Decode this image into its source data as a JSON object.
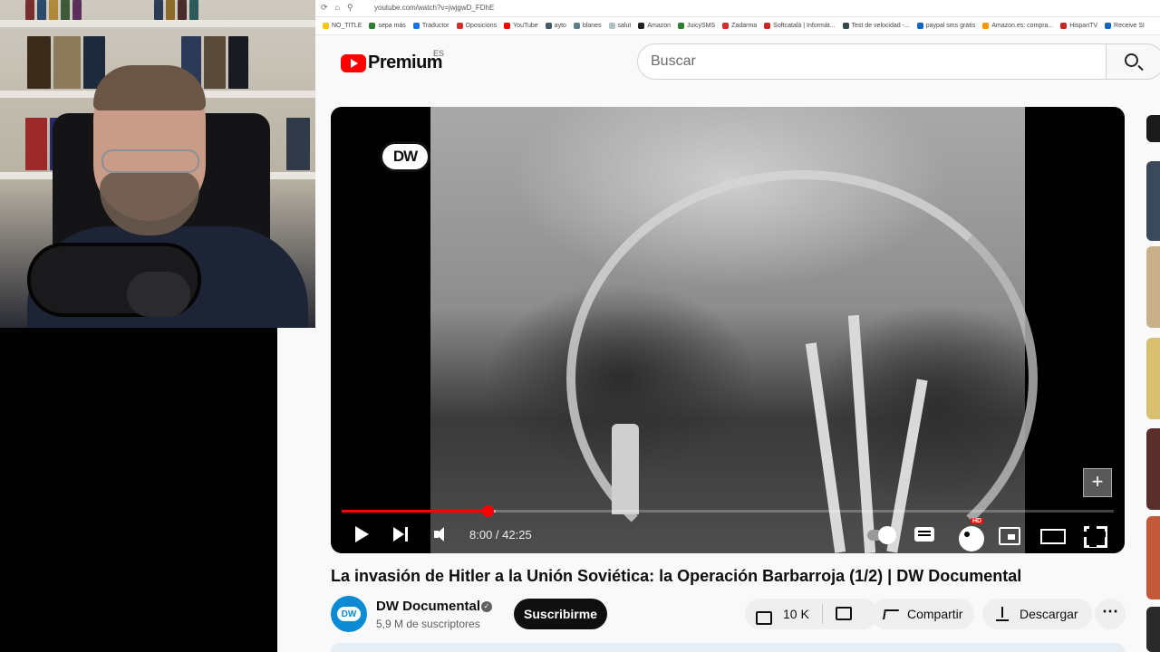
{
  "browser": {
    "url": "youtube.com/watch?v=jwjgwD_FDhE",
    "bookmarks": [
      {
        "label": "NO_TITLE",
        "color": "#f5c518"
      },
      {
        "label": "sepa más",
        "color": "#2e7d32"
      },
      {
        "label": "Traductor",
        "color": "#1a73e8"
      },
      {
        "label": "Oposicions",
        "color": "#d32f2f"
      },
      {
        "label": "YouTube",
        "color": "#ff0000"
      },
      {
        "label": "ayto",
        "color": "#455a64"
      },
      {
        "label": "blanes",
        "color": "#607d8b"
      },
      {
        "label": "salut",
        "color": "#b0bec5"
      },
      {
        "label": "Amazon",
        "color": "#222222"
      },
      {
        "label": "JuicySMS",
        "color": "#2e7d32"
      },
      {
        "label": "Zadarma",
        "color": "#d32f2f"
      },
      {
        "label": "Softcatalà | Informàt...",
        "color": "#c62828"
      },
      {
        "label": "Test de velocidad -...",
        "color": "#37474f"
      },
      {
        "label": "paypal sms gratis",
        "color": "#1565c0"
      },
      {
        "label": "Amazon.es: compra...",
        "color": "#ff9800"
      },
      {
        "label": "HispanTV",
        "color": "#c62828"
      },
      {
        "label": "Receive SI",
        "color": "#1565c0"
      }
    ]
  },
  "header": {
    "logo_text": "Premium",
    "region": "ES",
    "search_placeholder": "Buscar"
  },
  "player": {
    "overlay_logo": "DW",
    "add_label": "+",
    "time_current": "8:00",
    "time_separator": " / ",
    "time_total": "42:25",
    "progress_fraction": 0.189,
    "buffered_fraction": 0.2,
    "hd_badge": "HD"
  },
  "video": {
    "title": "La invasión de Hitler a la Unión Soviética: la Operación Barbarroja (1/2) | DW Documental",
    "channel_avatar_text": "DW",
    "channel_name": "DW Documental",
    "verified_mark": "✓",
    "subscribers": "5,9 M de suscriptores",
    "subscribe_label": "Suscribirme",
    "like_count": "10 K",
    "share_label": "Compartir",
    "download_label": "Descargar",
    "more_label": "⋯"
  },
  "recommendations_peek": [
    {
      "color": "#1b1b1b"
    },
    {
      "color": "#3a4a5a"
    },
    {
      "color": "#c8b08a"
    },
    {
      "color": "#d8c070"
    },
    {
      "color": "#5a2f2a"
    },
    {
      "color": "#c25a3a"
    },
    {
      "color": "#2a2a2a"
    }
  ]
}
